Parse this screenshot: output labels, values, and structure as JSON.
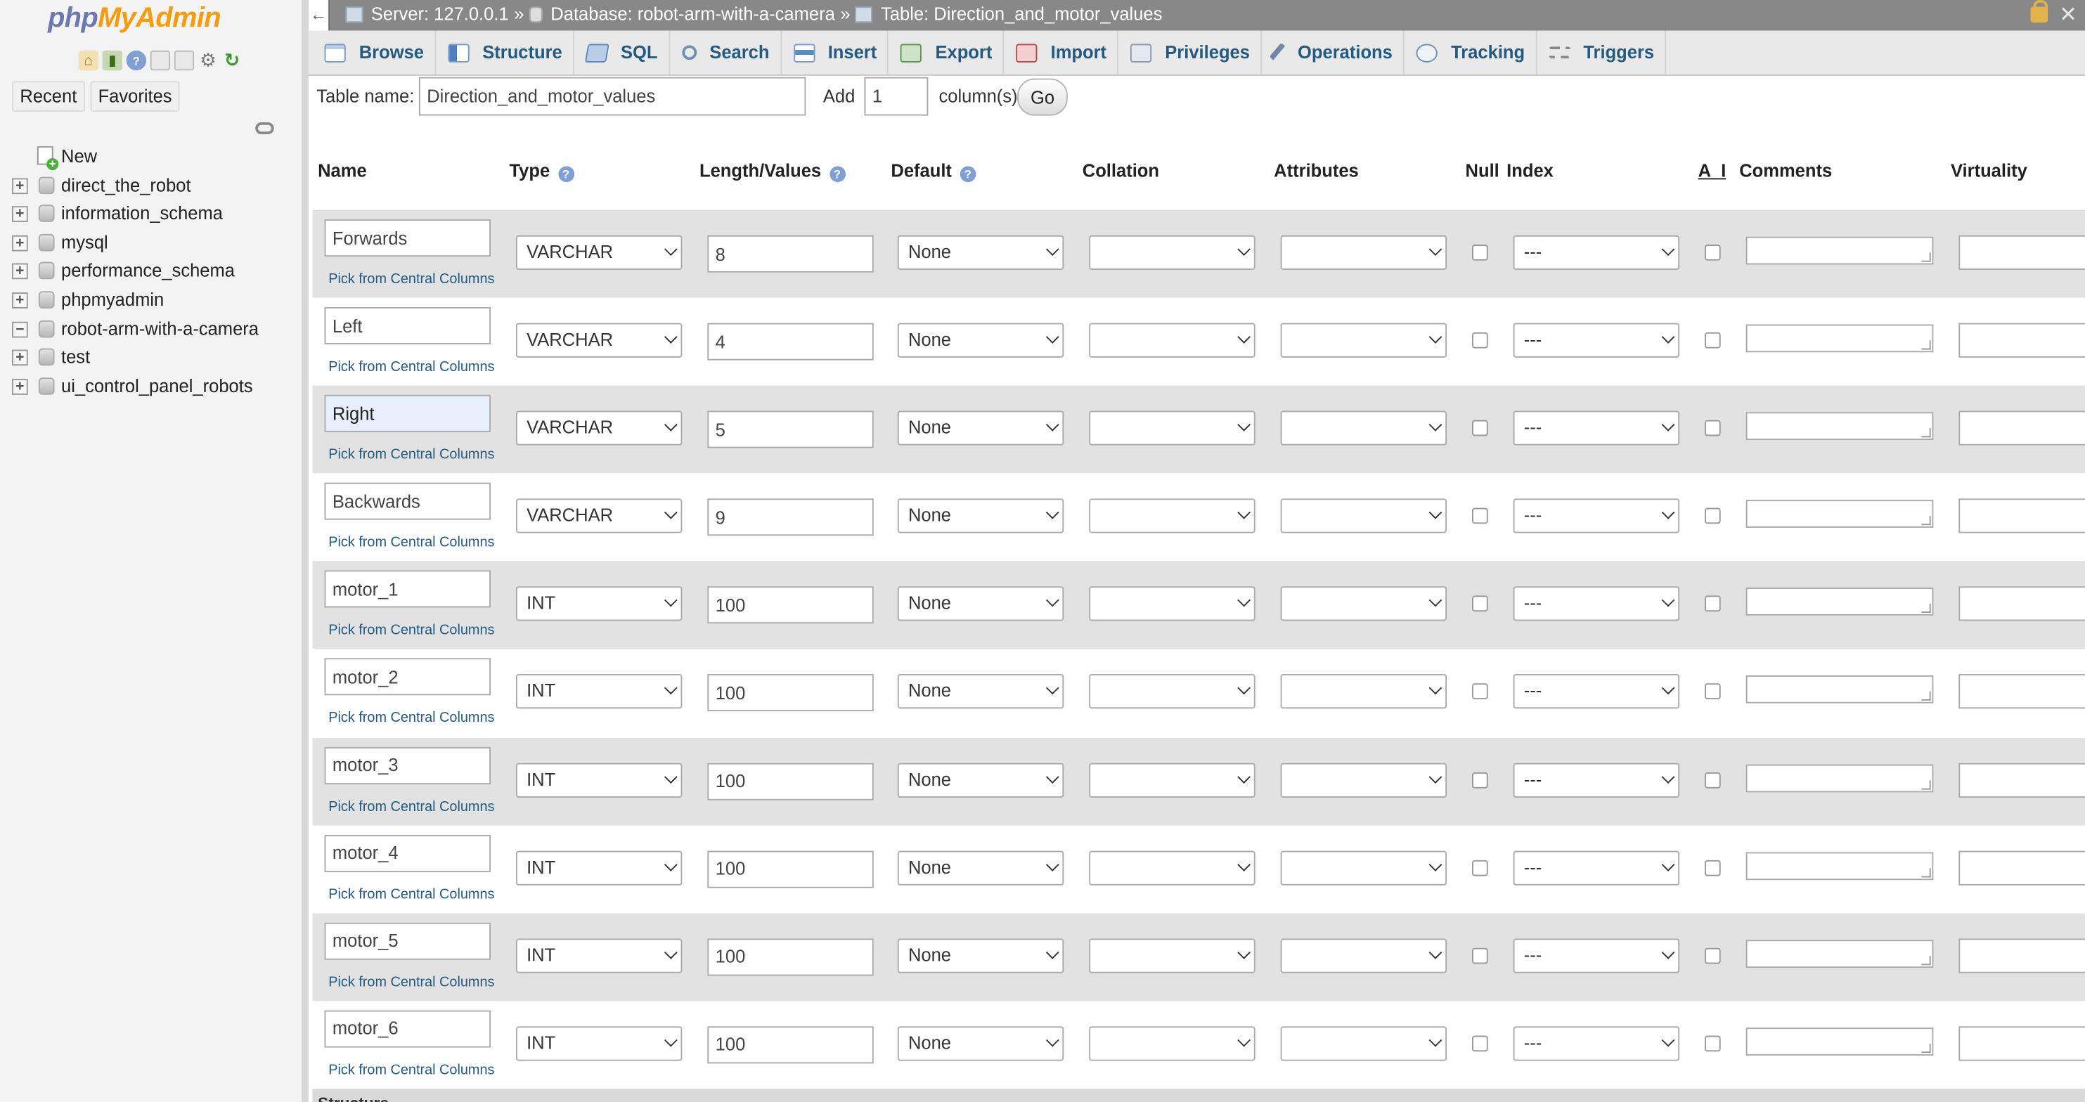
{
  "app": {
    "logo_php": "php",
    "logo_myadmin": "MyAdmin"
  },
  "nav": {
    "tabs": [
      "Recent",
      "Favorites"
    ],
    "new_label": "New",
    "databases": [
      {
        "name": "direct_the_robot",
        "expanded": false
      },
      {
        "name": "information_schema",
        "expanded": false
      },
      {
        "name": "mysql",
        "expanded": false
      },
      {
        "name": "performance_schema",
        "expanded": false
      },
      {
        "name": "phpmyadmin",
        "expanded": false
      },
      {
        "name": "robot-arm-with-a-camera",
        "expanded": true
      },
      {
        "name": "test",
        "expanded": false
      },
      {
        "name": "ui_control_panel_robots",
        "expanded": false
      }
    ]
  },
  "breadcrumb": {
    "server": "Server: 127.0.0.1",
    "database": "Database: robot-arm-with-a-camera",
    "table": "Table: Direction_and_motor_values",
    "sep": "»"
  },
  "tabs": [
    {
      "label": "Browse",
      "icon": "browse-icon"
    },
    {
      "label": "Structure",
      "icon": "structure-icon"
    },
    {
      "label": "SQL",
      "icon": "sql-icon"
    },
    {
      "label": "Search",
      "icon": "search-icon"
    },
    {
      "label": "Insert",
      "icon": "insert-icon"
    },
    {
      "label": "Export",
      "icon": "export-icon"
    },
    {
      "label": "Import",
      "icon": "import-icon"
    },
    {
      "label": "Privileges",
      "icon": "privileges-icon"
    },
    {
      "label": "Operations",
      "icon": "operations-icon"
    },
    {
      "label": "Tracking",
      "icon": "tracking-icon"
    },
    {
      "label": "Triggers",
      "icon": "triggers-icon"
    }
  ],
  "form": {
    "table_name_label": "Table name:",
    "table_name_value": "Direction_and_motor_values",
    "add_label": "Add",
    "add_value": "1",
    "columns_label": "column(s)",
    "go_label": "Go"
  },
  "columns_header": {
    "name": "Name",
    "type": "Type",
    "length": "Length/Values",
    "default": "Default",
    "collation": "Collation",
    "attributes": "Attributes",
    "null": "Null",
    "index": "Index",
    "ai": "A_I",
    "comments": "Comments",
    "virtuality": "Virtuality",
    "help_glyph": "?"
  },
  "pick_label": "Pick from Central Columns",
  "fields": [
    {
      "name": "Forwards",
      "type": "VARCHAR",
      "length": "8",
      "default": "None",
      "collation": "",
      "attributes": "",
      "index": "---"
    },
    {
      "name": "Left",
      "type": "VARCHAR",
      "length": "4",
      "default": "None",
      "collation": "",
      "attributes": "",
      "index": "---"
    },
    {
      "name": "Right",
      "type": "VARCHAR",
      "length": "5",
      "default": "None",
      "collation": "",
      "attributes": "",
      "index": "---"
    },
    {
      "name": "Backwards",
      "type": "VARCHAR",
      "length": "9",
      "default": "None",
      "collation": "",
      "attributes": "",
      "index": "---"
    },
    {
      "name": "motor_1",
      "type": "INT",
      "length": "100",
      "default": "None",
      "collation": "",
      "attributes": "",
      "index": "---"
    },
    {
      "name": "motor_2",
      "type": "INT",
      "length": "100",
      "default": "None",
      "collation": "",
      "attributes": "",
      "index": "---"
    },
    {
      "name": "motor_3",
      "type": "INT",
      "length": "100",
      "default": "None",
      "collation": "",
      "attributes": "",
      "index": "---"
    },
    {
      "name": "motor_4",
      "type": "INT",
      "length": "100",
      "default": "None",
      "collation": "",
      "attributes": "",
      "index": "---"
    },
    {
      "name": "motor_5",
      "type": "INT",
      "length": "100",
      "default": "None",
      "collation": "",
      "attributes": "",
      "index": "---"
    },
    {
      "name": "motor_6",
      "type": "INT",
      "length": "100",
      "default": "None",
      "collation": "",
      "attributes": "",
      "index": "---"
    }
  ],
  "bottom_label": "Structure"
}
